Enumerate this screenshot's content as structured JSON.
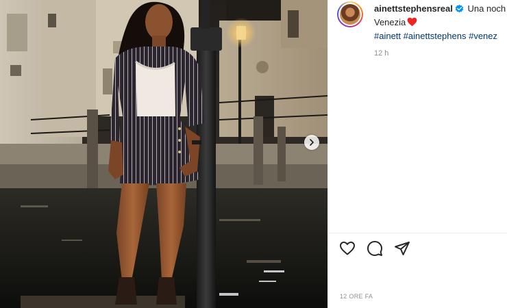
{
  "post": {
    "username": "ainettstephensreal",
    "caption_line1": "Una noch",
    "caption_line2": "Venezia",
    "hashtags": [
      "#ainett",
      "#ainettstephens",
      "#venez"
    ],
    "time_ago": "12 h",
    "date_label": "12 ORE FA"
  },
  "icons": {
    "verified": "verified-badge-icon",
    "heart_emoji": "red-heart-emoji",
    "like": "heart-outline-icon",
    "comment": "comment-bubble-icon",
    "share": "paper-plane-icon",
    "carousel_next": "chevron-right-icon"
  },
  "colors": {
    "verified_blue": "#0095f6",
    "hashtag_link": "#00376b",
    "heart_red": "#ed2525",
    "muted_text": "#8e8e8e"
  }
}
